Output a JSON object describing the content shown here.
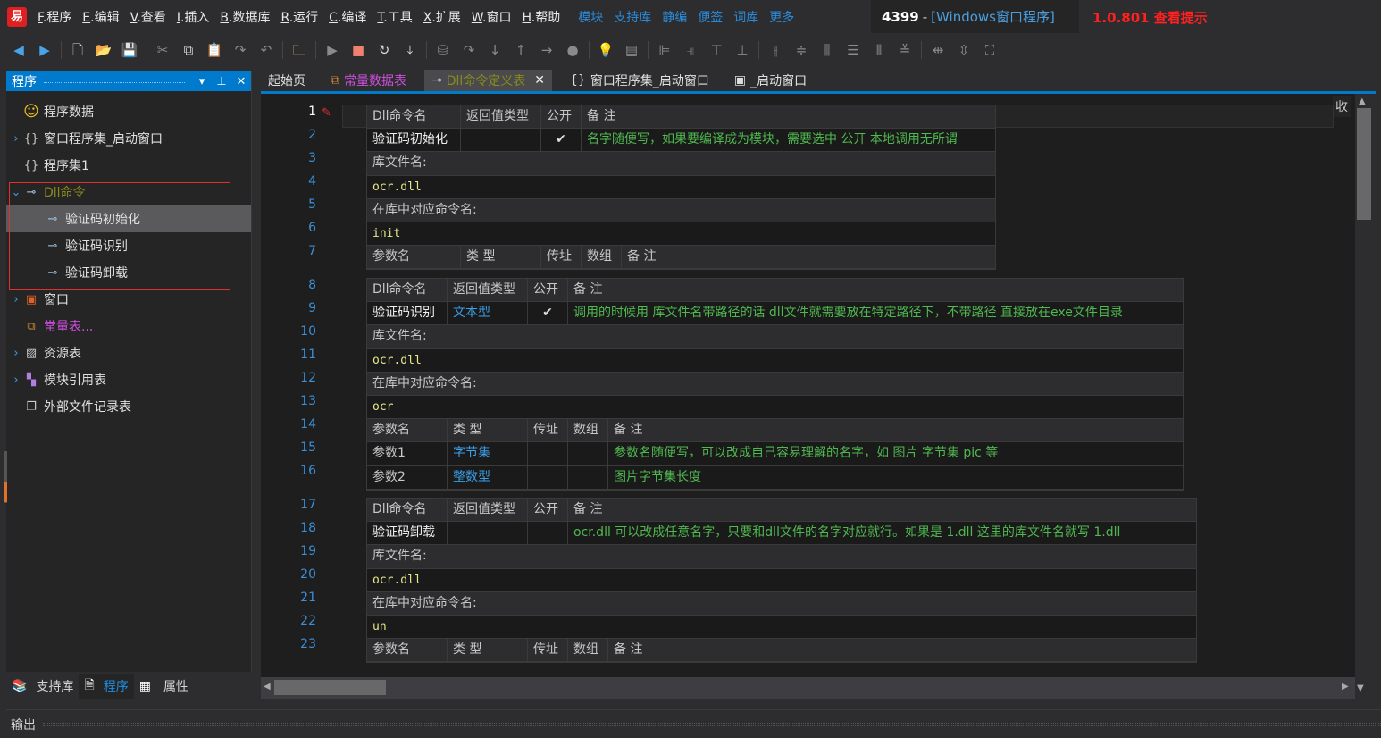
{
  "menubar": {
    "items": [
      {
        "key": "F",
        "label": ".程序"
      },
      {
        "key": "E",
        "label": ".编辑"
      },
      {
        "key": "V",
        "label": ".查看"
      },
      {
        "key": "I",
        "label": ".插入"
      },
      {
        "key": "B",
        "label": ".数据库"
      },
      {
        "key": "R",
        "label": ".运行"
      },
      {
        "key": "C",
        "label": ".编译"
      },
      {
        "key": "T",
        "label": ".工具"
      },
      {
        "key": "X",
        "label": ".扩展"
      },
      {
        "key": "W",
        "label": ".窗口"
      },
      {
        "key": "H",
        "label": ".帮助"
      }
    ],
    "quick_links": [
      "模块",
      "支持库",
      "静编",
      "便签",
      "词库",
      "更多"
    ]
  },
  "title": {
    "num": "4399",
    "sep": "-",
    "text": "[Windows窗口程序]"
  },
  "version": "1.0.801 查看提示",
  "left_panel": {
    "title": "程序",
    "tree": [
      {
        "label": "程序数据",
        "icon": "smiley-icon",
        "glyph": "☺",
        "chev": "",
        "indent": 0,
        "color": "#e0e0e0"
      },
      {
        "label": "窗口程序集_启动窗口",
        "icon": "braces-icon",
        "glyph": "{}",
        "chev": ">",
        "indent": 0,
        "color": "#e0e0e0"
      },
      {
        "label": "程序集1",
        "icon": "braces-icon",
        "glyph": "{}",
        "chev": "",
        "indent": 0,
        "color": "#e0e0e0"
      },
      {
        "label": "Dll命令",
        "icon": "key-icon",
        "glyph": "⊸",
        "chev": "⌄",
        "indent": 0,
        "color": "#8a8a1a"
      },
      {
        "label": "验证码初始化",
        "icon": "key-icon",
        "glyph": "⊸",
        "chev": "",
        "indent": 1,
        "color": "#e0e0e0",
        "selected": true
      },
      {
        "label": "验证码识别",
        "icon": "key-icon",
        "glyph": "⊸",
        "chev": "",
        "indent": 1,
        "color": "#e0e0e0"
      },
      {
        "label": "验证码卸载",
        "icon": "key-icon",
        "glyph": "⊸",
        "chev": "",
        "indent": 1,
        "color": "#e0e0e0"
      },
      {
        "label": "窗口",
        "icon": "window-icon",
        "glyph": "▣",
        "chev": ">",
        "indent": 0,
        "color": "#e0e0e0"
      },
      {
        "label": "常量表...",
        "icon": "constant-table-icon",
        "glyph": "⧉",
        "chev": "",
        "indent": 0,
        "color": "#d050e0"
      },
      {
        "label": "资源表",
        "icon": "image-icon",
        "glyph": "▨",
        "chev": ">",
        "indent": 0,
        "color": "#e0e0e0"
      },
      {
        "label": "模块引用表",
        "icon": "module-icon",
        "glyph": "▚",
        "chev": ">",
        "indent": 0,
        "color": "#e0e0e0"
      },
      {
        "label": "外部文件记录表",
        "icon": "file-icon",
        "glyph": "❐",
        "chev": "",
        "indent": 0,
        "color": "#e0e0e0"
      }
    ],
    "bottom_tabs": [
      "支持库",
      "程序",
      "属性"
    ]
  },
  "editor_tabs": [
    {
      "label": "起始页",
      "icon": ""
    },
    {
      "label": "常量数据表",
      "icon": "⧉",
      "color": "#d050e0"
    },
    {
      "label": "Dll命令定义表",
      "icon": "⊸",
      "active": true
    },
    {
      "label": "窗口程序集_启动窗口",
      "icon": "{}"
    },
    {
      "label": "_启动窗口",
      "icon": "▣"
    }
  ],
  "collapse_label": "收",
  "output_label": "输出",
  "dll_tables": [
    {
      "header": [
        "Dll命令名",
        "返回值类型",
        "公开",
        "备 注"
      ],
      "row": {
        "name": "验证码初始化",
        "ret": "",
        "public": "✔",
        "note": "名字随便写，如果要编译成为模块，需要选中 公开 本地调用无所谓"
      },
      "lib_label": "库文件名:",
      "lib": "ocr.dll",
      "cmd_label": "在库中对应命令名:",
      "cmd": "init",
      "param_header": [
        "参数名",
        "类 型",
        "传址",
        "数组",
        "备 注"
      ],
      "params": []
    },
    {
      "header": [
        "Dll命令名",
        "返回值类型",
        "公开",
        "备 注"
      ],
      "row": {
        "name": "验证码识别",
        "ret": "文本型",
        "public": "✔",
        "note": "调用的时候用 库文件名带路径的话  dll文件就需要放在特定路径下，不带路径 直接放在exe文件目录"
      },
      "lib_label": "库文件名:",
      "lib": "ocr.dll",
      "cmd_label": "在库中对应命令名:",
      "cmd": "ocr",
      "param_header": [
        "参数名",
        "类 型",
        "传址",
        "数组",
        "备 注"
      ],
      "params": [
        {
          "name": "参数1",
          "type": "字节集",
          "byref": "",
          "array": "",
          "note": "参数名随便写，可以改成自己容易理解的名字，如 图片 字节集 pic 等"
        },
        {
          "name": "参数2",
          "type": "整数型",
          "byref": "",
          "array": "",
          "note": "图片字节集长度"
        }
      ]
    },
    {
      "header": [
        "Dll命令名",
        "返回值类型",
        "公开",
        "备 注"
      ],
      "row": {
        "name": "验证码卸载",
        "ret": "",
        "public": "",
        "note": "ocr.dll 可以改成任意名字，只要和dll文件的名字对应就行。如果是 1.dll 这里的库文件名就写 1.dll"
      },
      "lib_label": "库文件名:",
      "lib": "ocr.dll",
      "cmd_label": "在库中对应命令名:",
      "cmd": "un",
      "param_header": [
        "参数名",
        "类 型",
        "传址",
        "数组",
        "备 注"
      ],
      "params": []
    }
  ],
  "line_numbers": [
    "1",
    "2",
    "3",
    "4",
    "5",
    "6",
    "7",
    "8",
    "9",
    "10",
    "11",
    "12",
    "13",
    "14",
    "15",
    "16",
    "17",
    "18",
    "19",
    "20",
    "21",
    "22",
    "23"
  ]
}
